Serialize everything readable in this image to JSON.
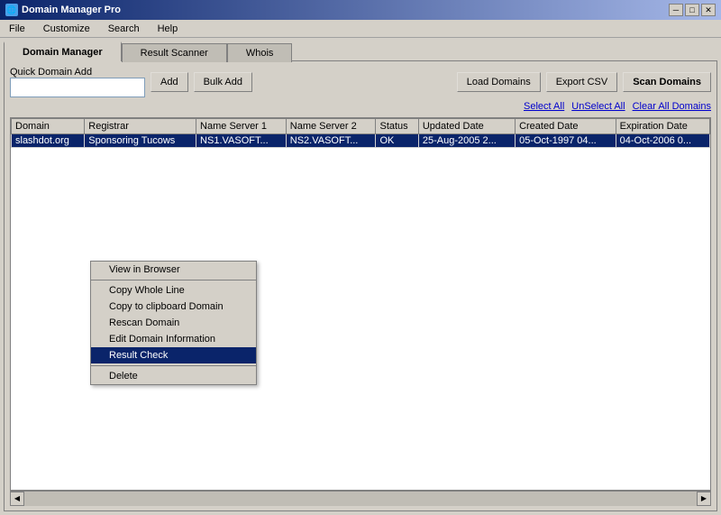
{
  "window": {
    "title": "Domain Manager Pro",
    "title_icon": "🌐"
  },
  "menu": {
    "items": [
      "File",
      "Customize",
      "Search",
      "Help"
    ]
  },
  "tabs": [
    {
      "label": "Domain Manager",
      "active": true
    },
    {
      "label": "Result Scanner",
      "active": false
    },
    {
      "label": "Whois",
      "active": false
    }
  ],
  "toolbar": {
    "quick_add_label": "Quick Domain Add",
    "add_btn": "Add",
    "bulk_add_btn": "Bulk Add",
    "load_domains_btn": "Load Domains",
    "export_csv_btn": "Export CSV",
    "scan_domains_btn": "Scan Domains",
    "select_all_btn": "Select All",
    "unselect_all_btn": "UnSelect All",
    "clear_all_btn": "Clear All Domains",
    "quick_add_placeholder": ""
  },
  "table": {
    "columns": [
      "Domain",
      "Registrar",
      "Name Server 1",
      "Name Server 2",
      "Status",
      "Updated Date",
      "Created Date",
      "Expiration Date"
    ],
    "rows": [
      {
        "domain": "slashdot.org",
        "registrar": "Sponsoring Tucows",
        "ns1": "NS1.VASOFT...",
        "ns2": "NS2.VASOFT...",
        "status": "OK",
        "updated": "25-Aug-2005 2...",
        "created": "05-Oct-1997 04...",
        "expiration": "04-Oct-2006 0...",
        "selected": true
      }
    ]
  },
  "context_menu": {
    "items": [
      {
        "label": "View in Browser",
        "highlighted": false,
        "separator_before": false
      },
      {
        "label": "Copy Whole Line",
        "highlighted": false,
        "separator_before": false
      },
      {
        "label": "Copy to clipboard Domain",
        "highlighted": false,
        "separator_before": false
      },
      {
        "label": "Rescan Domain",
        "highlighted": false,
        "separator_before": false
      },
      {
        "label": "Edit Domain Information",
        "highlighted": false,
        "separator_before": false
      },
      {
        "label": "Result Check",
        "highlighted": true,
        "separator_before": false
      },
      {
        "label": "Delete",
        "highlighted": false,
        "separator_before": true
      }
    ]
  },
  "title_buttons": {
    "minimize": "─",
    "maximize": "□",
    "close": "✕"
  }
}
